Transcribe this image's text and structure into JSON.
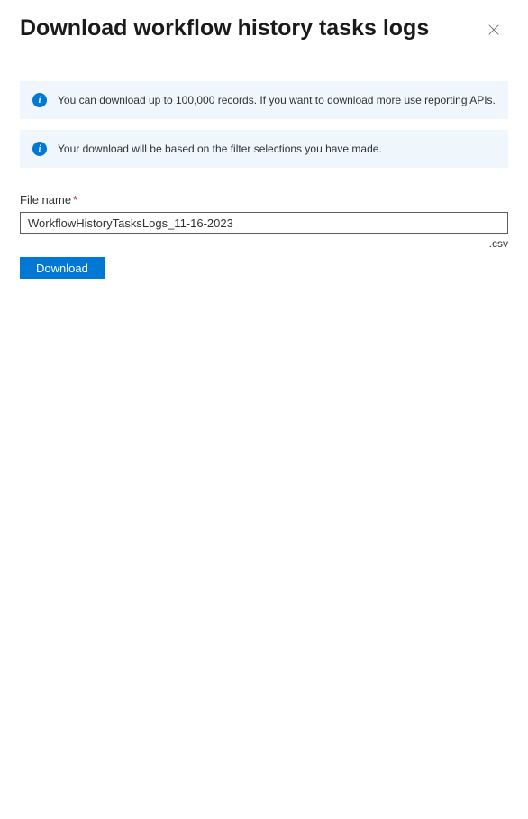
{
  "header": {
    "title": "Download workflow history tasks logs"
  },
  "info_messages": [
    "You can download up to 100,000 records. If you want to download more use reporting APIs.",
    "Your download will be based on the filter selections you have made."
  ],
  "form": {
    "file_name_label": "File name",
    "file_name_value": "WorkflowHistoryTasksLogs_11-16-2023",
    "extension": ".csv",
    "download_label": "Download"
  }
}
